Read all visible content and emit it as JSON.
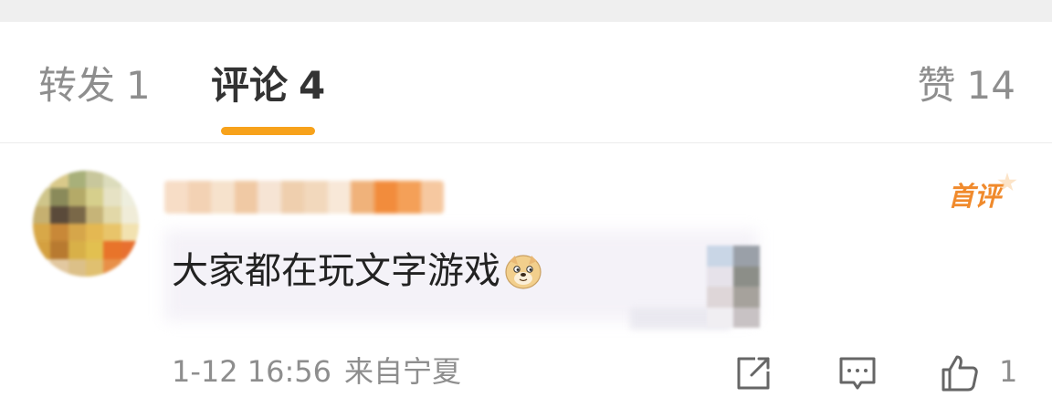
{
  "tabs": {
    "repost": {
      "label": "转发",
      "count": "1"
    },
    "comment": {
      "label": "评论",
      "count": "4"
    },
    "like": {
      "label": "赞",
      "count": "14"
    },
    "active": "comment",
    "accent_color": "#f7a21b"
  },
  "comment": {
    "badge": "首评",
    "text": "大家都在玩文字游戏",
    "emoji": "doge-emoji",
    "time": "1-12 16:56",
    "source": "来自宁夏",
    "like_count": "1"
  },
  "icons": {
    "share": "share-external-icon",
    "reply": "reply-comment-icon",
    "like": "thumbs-up-icon"
  }
}
